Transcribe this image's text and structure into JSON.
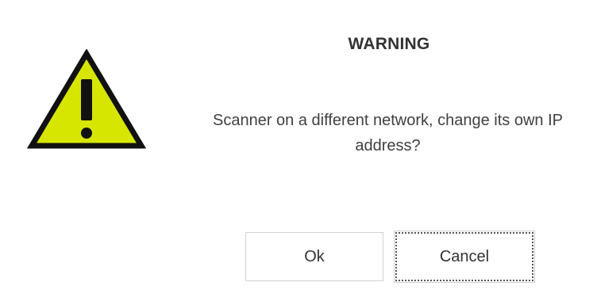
{
  "dialog": {
    "title": "WARNING",
    "message": "Scanner on a different network, change its own IP address?",
    "icon": "warning-icon",
    "buttons": {
      "ok_label": "Ok",
      "cancel_label": "Cancel"
    }
  },
  "colors": {
    "warning_fill": "#d7e600",
    "warning_stroke": "#111111",
    "button_border": "#d2d2d2",
    "focus_outline": "#555555"
  }
}
